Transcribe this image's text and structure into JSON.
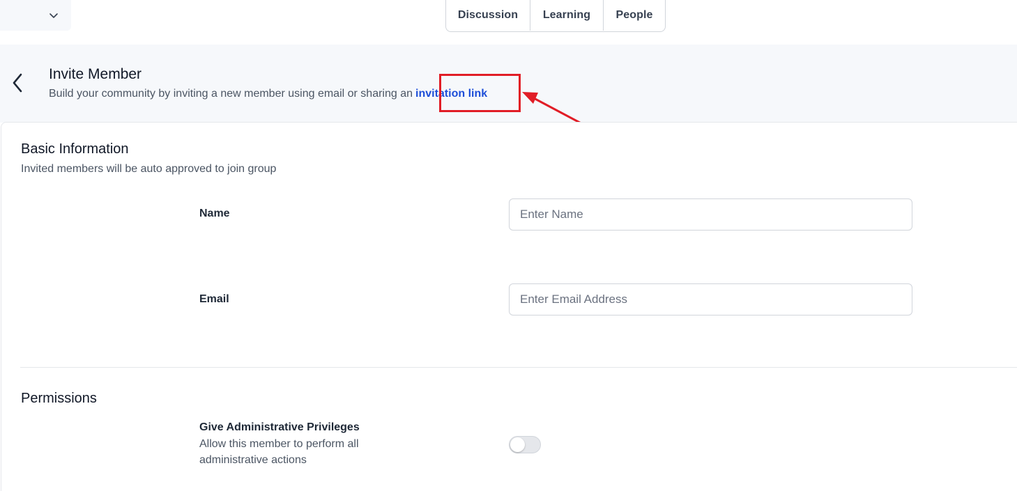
{
  "nav": {
    "tabs": [
      {
        "label": "Discussion"
      },
      {
        "label": "Learning"
      },
      {
        "label": "People"
      }
    ]
  },
  "header": {
    "title": "Invite Member",
    "subtitle": "Build your community by inviting a new member using email or sharing an",
    "link_text": "invitation link"
  },
  "basic_info": {
    "title": "Basic Information",
    "description": "Invited members will be auto approved to join group",
    "name_label": "Name",
    "name_placeholder": "Enter Name",
    "email_label": "Email",
    "email_placeholder": "Enter Email Address"
  },
  "permissions": {
    "title": "Permissions",
    "admin_label": "Give Administrative Privileges",
    "admin_description": "Allow this member to perform all administrative actions",
    "admin_enabled": false
  },
  "colors": {
    "accent_link": "#1d4ed8",
    "annotation": "#e11d26",
    "header_bg": "#f6f8fb"
  },
  "icons": {
    "dropdown": "chevron-down-icon",
    "back": "chevron-left-icon"
  }
}
